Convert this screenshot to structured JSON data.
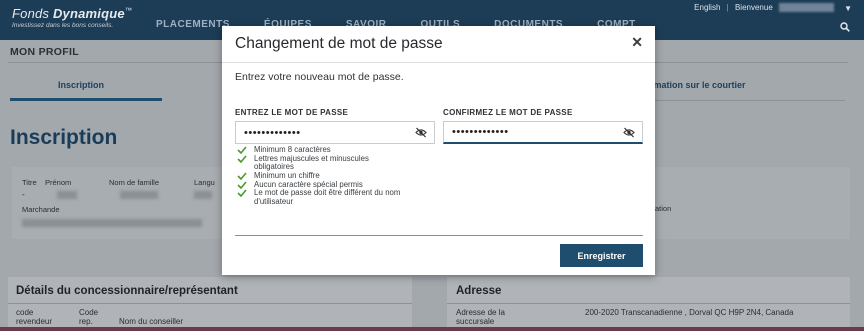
{
  "header": {
    "brand_prefix": "Fonds",
    "brand_name": "Dynamique",
    "brand_mark": "™",
    "tagline": "Investissez dans les bons conseils.",
    "nav": [
      "PLACEMENTS",
      "ÉQUIPES",
      "SAVOIR",
      "OUTILS",
      "DOCUMENTS",
      "COMPT"
    ],
    "lang_link": "English",
    "welcome": "Bienvenue",
    "search_icon": "search-icon",
    "caret_icon": "chevron-down-icon"
  },
  "page": {
    "profile_title": "MON PROFIL",
    "tabs": [
      "Inscription",
      "rmation sur le courtier"
    ],
    "heading": "Inscription",
    "info_labels": {
      "titre": "Titre",
      "prenom": "Prénom",
      "nom": "Nom de famille",
      "langue": "Langu",
      "marchande": "Marchande",
      "ation": "ation"
    },
    "titre_value": "-",
    "dealer_section": {
      "title": "Détails du concessionnaire/représentant",
      "col1": "code revendeur",
      "col2": "Code rep.",
      "col3": "Nom du conseiller"
    },
    "address_section": {
      "title": "Adresse",
      "label": "Adresse de la succursale",
      "value": "200-2020 Transcanadienne , Dorval QC H9P 2N4, Canada"
    }
  },
  "modal": {
    "title": "Changement de mot de passe",
    "close_icon": "close-icon",
    "intro": "Entrez votre nouveau mot de passe.",
    "field_new_label": "ENTREZ LE MOT DE PASSE",
    "field_new_value": "•••••••••••••",
    "field_confirm_label": "CONFIRMEZ LE MOT DE PASSE",
    "field_confirm_value": "•••••••••••••",
    "eye_icon": "eye-slash-icon",
    "check_icon": "check-icon",
    "rules": [
      "Minimum 8 caractères",
      "Lettres majuscules et minuscules obligatoires",
      "Minimum un chiffre",
      "Aucun caractère spécial permis",
      "Le mot de passe doit être différent du nom d'utilisateur"
    ],
    "save_label": "Enregistrer"
  },
  "colors": {
    "navy": "#1d3c56",
    "button": "#1e4d6d",
    "check": "#4a9a2e"
  }
}
